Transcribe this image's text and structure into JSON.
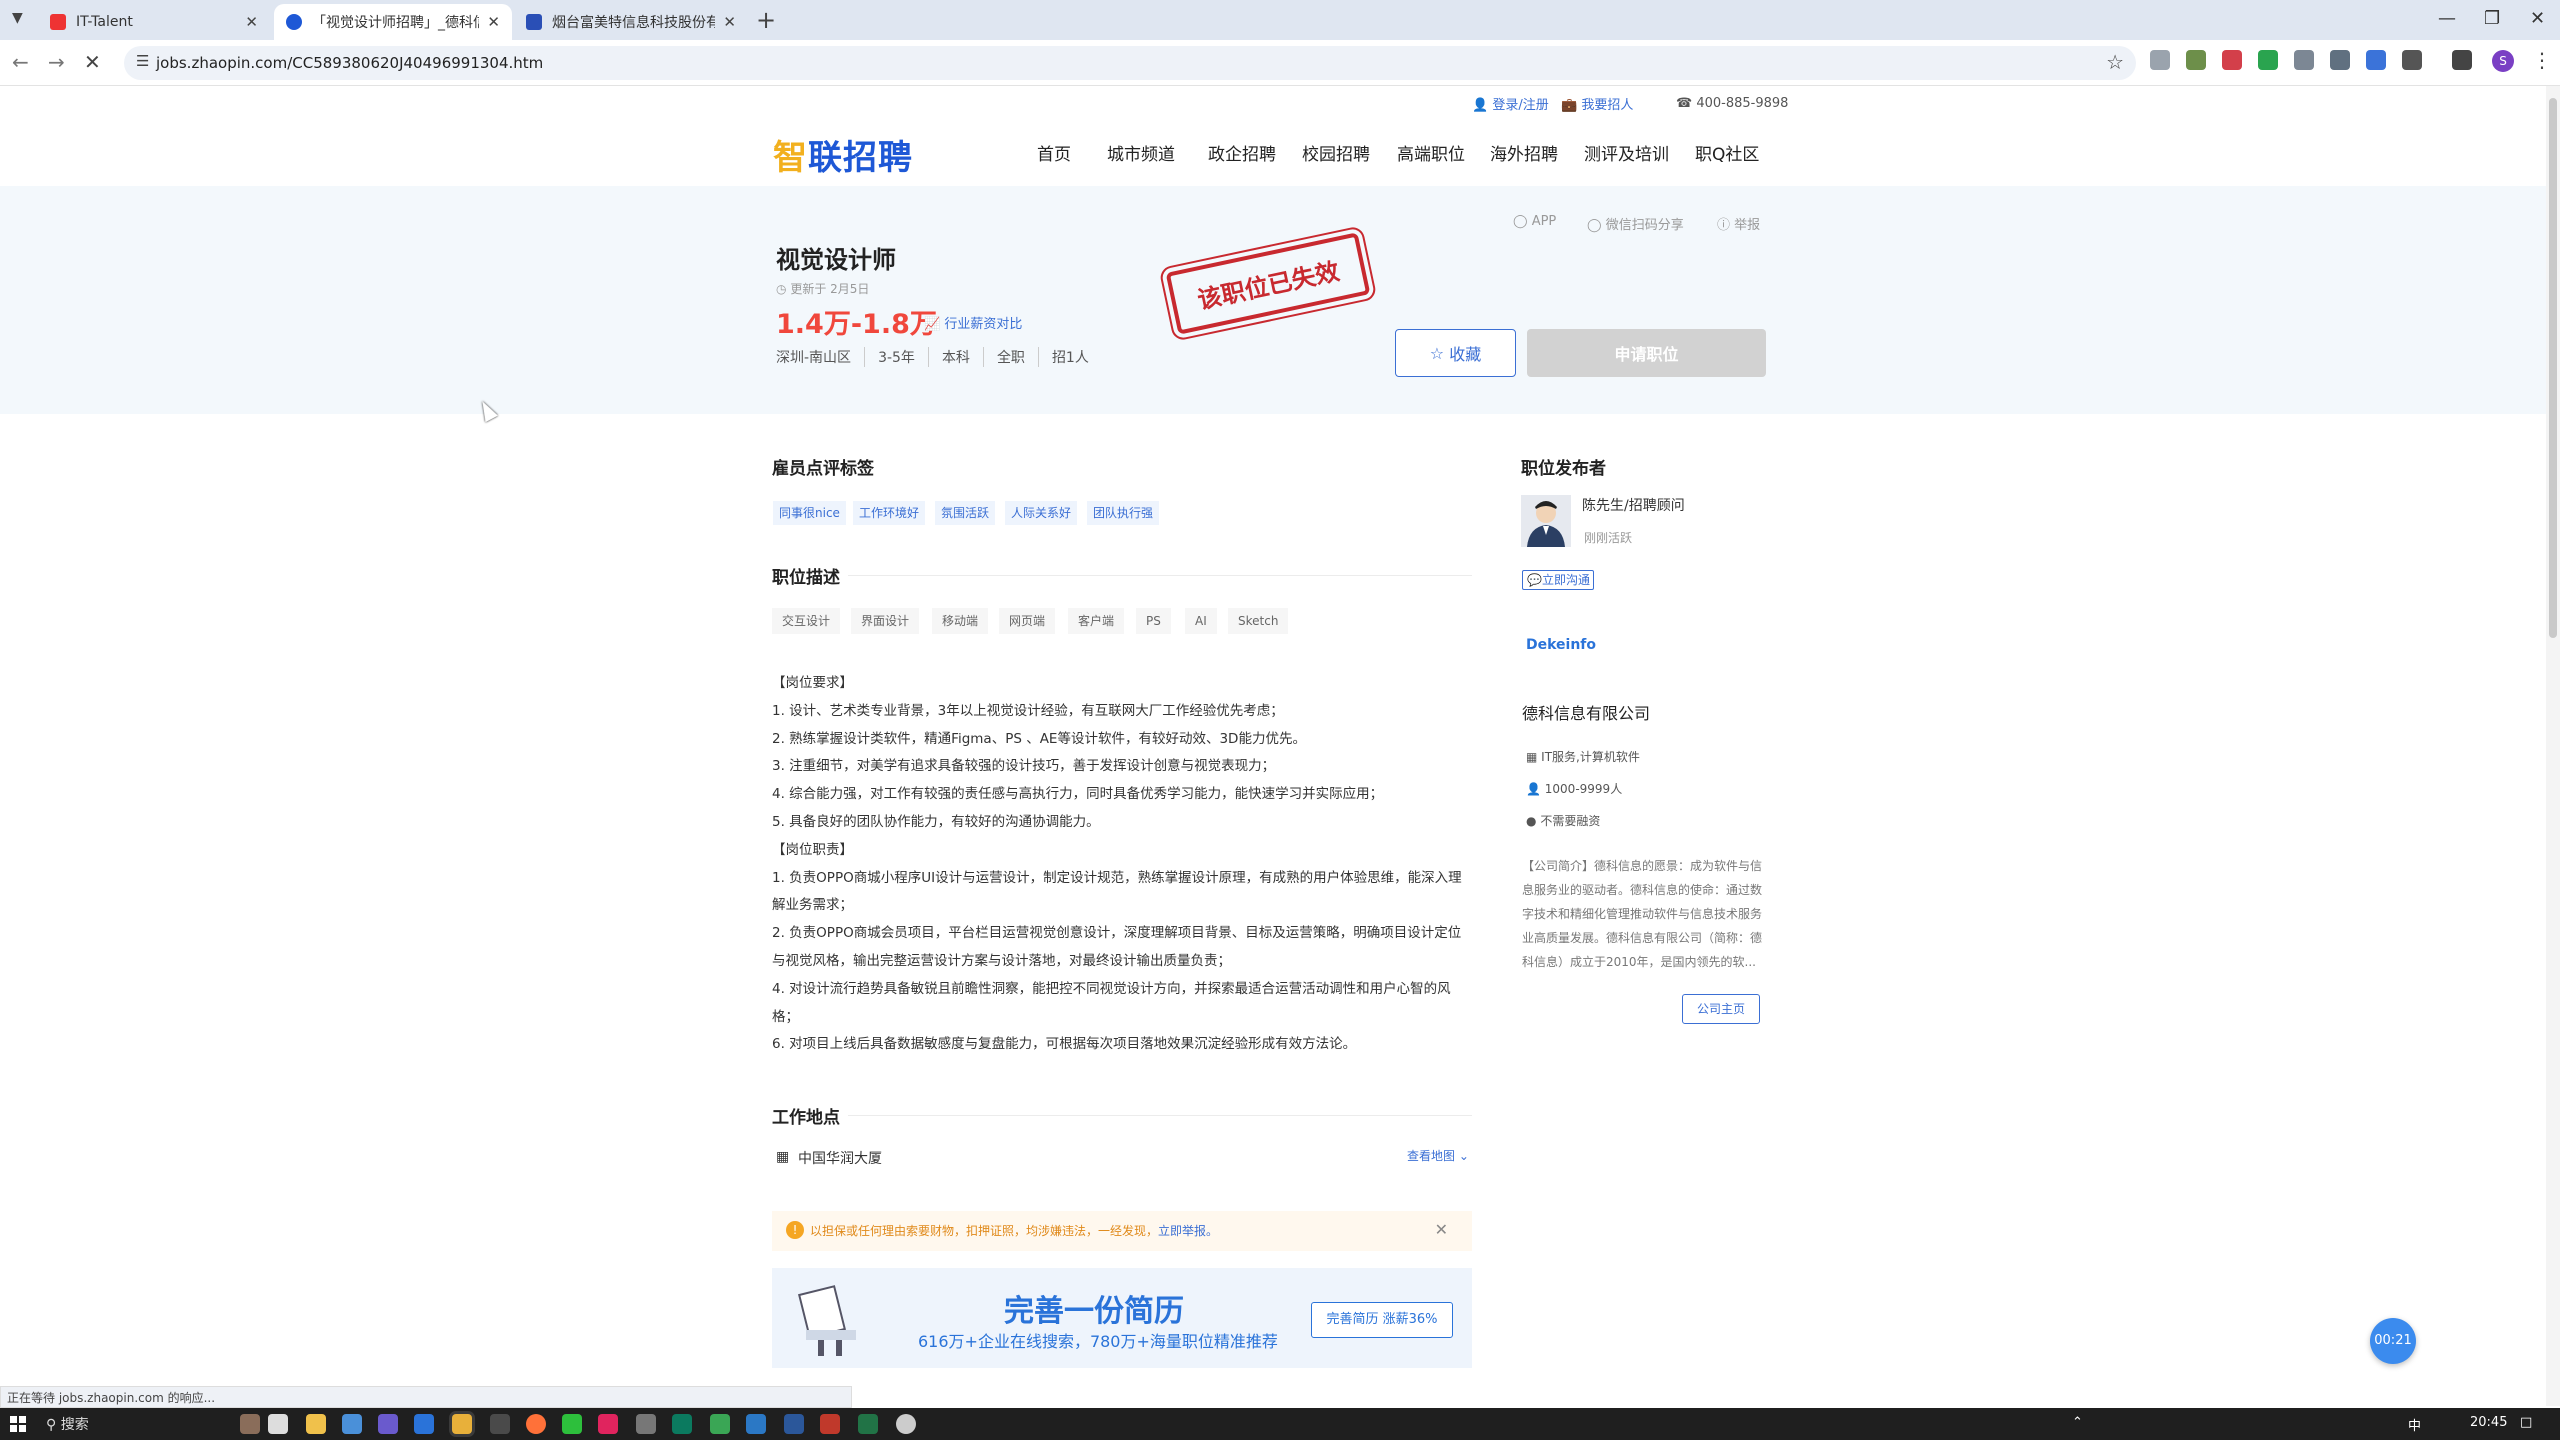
{
  "browser": {
    "tabs": [
      {
        "title": "IT-Talent",
        "active": false
      },
      {
        "title": "「视觉设计师招聘」_德科信息",
        "active": true
      },
      {
        "title": "烟台富美特信息科技股份有限公",
        "active": false
      }
    ],
    "url": "jobs.zhaopin.com/CC589380620J40496991304.htm",
    "profile_initial": "S"
  },
  "header": {
    "topbar": {
      "login": "登录/注册",
      "hire": "我要招人",
      "phone": "400-885-9898"
    },
    "logo": {
      "part1": "智",
      "part2": "联招聘"
    },
    "nav": [
      "首页",
      "城市频道",
      "政企招聘",
      "校园招聘",
      "高端职位",
      "海外招聘",
      "测评及培训",
      "职Q社区"
    ]
  },
  "job": {
    "title": "视觉设计师",
    "updated": "更新于 2月5日",
    "salary": "1.4万-1.8万",
    "compare": "行业薪资对比",
    "meta": [
      "深圳-南山区",
      "3-5年",
      "本科",
      "全职",
      "招1人"
    ],
    "stamp": "该职位已失效",
    "tools": {
      "app": "APP",
      "share": "微信扫码分享",
      "report": "举报"
    },
    "fav_button": "收藏",
    "apply_button": "申请职位"
  },
  "evaluation": {
    "title": "雇员点评标签",
    "tags": [
      "同事很nice",
      "工作环境好",
      "氛围活跃",
      "人际关系好",
      "团队执行强"
    ]
  },
  "description": {
    "title": "职位描述",
    "skills": [
      "交互设计",
      "界面设计",
      "移动端",
      "网页端",
      "客户端",
      "PS",
      "AI",
      "Sketch"
    ],
    "lines": [
      "【岗位要求】",
      "1. 设计、艺术类专业背景，3年以上视觉设计经验，有互联网大厂工作经验优先考虑；",
      "2. 熟练掌握设计类软件，精通Figma、PS 、AE等设计软件，有较好动效、3D能力优先。",
      "3. 注重细节，对美学有追求具备较强的设计技巧，善于发挥设计创意与视觉表现力；",
      "4. 综合能力强，对工作有较强的责任感与高执行力，同时具备优秀学习能力，能快速学习并实际应用；",
      "5. 具备良好的团队协作能力，有较好的沟通协调能力。",
      "【岗位职责】",
      "1. 负责OPPO商城小程序UI设计与运营设计，制定设计规范，熟练掌握设计原理，有成熟的用户体验思维，能深入理解业务需求；",
      "2. 负责OPPO商城会员项目，平台栏目运营视觉创意设计，深度理解项目背景、目标及运营策略，明确项目设计定位与视觉风格，输出完整运营设计方案与设计落地，对最终设计输出质量负责；",
      "4. 对设计流行趋势具备敏锐且前瞻性洞察，能把控不同视觉设计方向，并探索最适合运营活动调性和用户心智的风格；",
      "6. 对项目上线后具备数据敏感度与复盘能力，可根据每次项目落地效果沉淀经验形成有效方法论。"
    ]
  },
  "location": {
    "title": "工作地点",
    "name": "中国华润大厦",
    "map_link": "查看地图"
  },
  "warning": {
    "text": "以担保或任何理由索要财物，扣押证照，均涉嫌违法，一经发现，",
    "link": "立即举报。"
  },
  "resume": {
    "headline": "完善一份简历",
    "sub": "616万+企业在线搜索，780万+海量职位精准推荐",
    "button": "完善简历 涨薪36%"
  },
  "recruiter": {
    "section": "职位发布者",
    "name": "陈先生/招聘顾问",
    "status": "刚刚活跃",
    "chat": "立即沟通"
  },
  "company": {
    "logo_text": "Dekeinfo",
    "name": "德科信息有限公司",
    "industry": "IT服务,计算机软件",
    "size": "1000-9999人",
    "funding": "不需要融资",
    "intro": "【公司简介】德科信息的愿景：成为软件与信息服务业的驱动者。德科信息的使命：通过数字技术和精细化管理推动软件与信息技术服务业高质量发展。德科信息有限公司（简称：德科信息）成立于2010年，是国内领先的软...",
    "homepage": "公司主页"
  },
  "timer": "00:21",
  "status_text": "正在等待 jobs.zhaopin.com 的响应...",
  "taskbar": {
    "search": "搜索",
    "ime": "中",
    "time": "20:45"
  },
  "colors": {
    "brand": "#1e58d6",
    "salary": "#f0473c",
    "stamp": "#c8292f",
    "link": "#3b6fd4"
  }
}
